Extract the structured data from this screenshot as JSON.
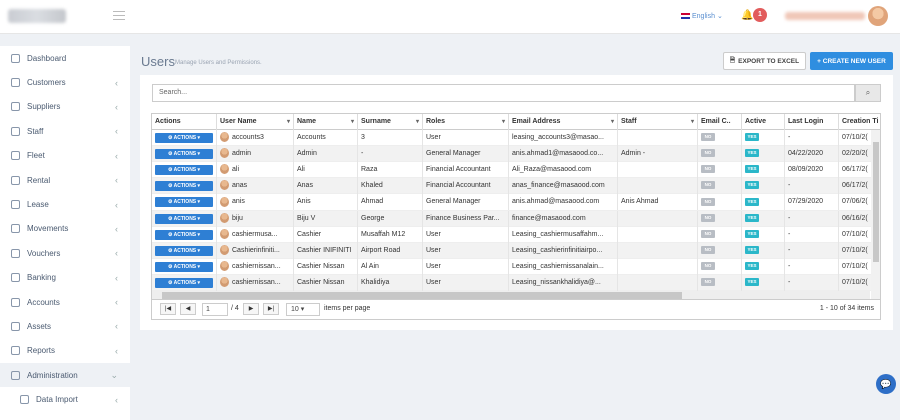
{
  "header": {
    "language": "English",
    "notifications_count": "1"
  },
  "sidebar": {
    "items": [
      {
        "label": "Dashboard",
        "icon": "home-icon",
        "chevron": false
      },
      {
        "label": "Customers",
        "icon": "users-icon",
        "chevron": true
      },
      {
        "label": "Suppliers",
        "icon": "suppliers-icon",
        "chevron": true
      },
      {
        "label": "Staff",
        "icon": "staff-icon",
        "chevron": true
      },
      {
        "label": "Fleet",
        "icon": "gauge-icon",
        "chevron": true
      },
      {
        "label": "Rental",
        "icon": "calendar-icon",
        "chevron": true
      },
      {
        "label": "Lease",
        "icon": "layers-icon",
        "chevron": true
      },
      {
        "label": "Movements",
        "icon": "car-icon",
        "chevron": true
      },
      {
        "label": "Vouchers",
        "icon": "ticket-icon",
        "chevron": true
      },
      {
        "label": "Banking",
        "icon": "bank-icon",
        "chevron": true
      },
      {
        "label": "Accounts",
        "icon": "ledger-icon",
        "chevron": true
      },
      {
        "label": "Assets",
        "icon": "diamond-icon",
        "chevron": true
      },
      {
        "label": "Reports",
        "icon": "chart-icon",
        "chevron": true
      },
      {
        "label": "Administration",
        "icon": "wrench-icon",
        "chevron": true,
        "active": true
      },
      {
        "label": "Data Import",
        "icon": "arrow-icon",
        "chevron": true,
        "sub": true
      }
    ]
  },
  "page": {
    "title": "Users",
    "subtitle": "Manage Users and Permissions.",
    "export_label": "EXPORT TO EXCEL",
    "create_label": "+ CREATE NEW USER",
    "search_placeholder": "Search..."
  },
  "table": {
    "columns": [
      "Actions",
      "User Name",
      "Name",
      "Surname",
      "Roles",
      "Email Address",
      "Staff",
      "Email C..",
      "Active",
      "Last Login",
      "Creation Ti"
    ],
    "action_label": "ACTIONS",
    "rows": [
      {
        "username": "accounts3",
        "name": "Accounts",
        "surname": "3",
        "role": "User",
        "email": "leasing_accounts3@masao...",
        "staff": "",
        "email_confirmed": "NO",
        "active": "YES",
        "last_login": "-",
        "creation": "07/10/2("
      },
      {
        "username": "admin",
        "name": "Admin",
        "surname": "-",
        "role": "General Manager",
        "email": "anis.ahmad1@masaood.co...",
        "staff": "Admin -",
        "email_confirmed": "NO",
        "active": "YES",
        "last_login": "04/22/2020",
        "creation": "02/20/2("
      },
      {
        "username": "ali",
        "name": "Ali",
        "surname": "Raza",
        "role": "Financial Accountant",
        "email": "Ali_Raza@masaood.com",
        "staff": "",
        "email_confirmed": "NO",
        "active": "YES",
        "last_login": "08/09/2020",
        "creation": "06/17/2("
      },
      {
        "username": "anas",
        "name": "Anas",
        "surname": "Khaled",
        "role": "Financial Accountant",
        "email": "anas_finance@masaood.com",
        "staff": "",
        "email_confirmed": "NO",
        "active": "YES",
        "last_login": "-",
        "creation": "06/17/2("
      },
      {
        "username": "anis",
        "name": "Anis",
        "surname": "Ahmad",
        "role": "General Manager",
        "email": "anis.ahmad@masaood.com",
        "staff": "Anis Ahmad",
        "email_confirmed": "NO",
        "active": "YES",
        "last_login": "07/29/2020",
        "creation": "07/06/2("
      },
      {
        "username": "biju",
        "name": "Biju V",
        "surname": "George",
        "role": "Finance Business Par...",
        "email": "finance@masaood.com",
        "staff": "",
        "email_confirmed": "NO",
        "active": "YES",
        "last_login": "-",
        "creation": "06/16/2("
      },
      {
        "username": "cashiermusa...",
        "name": "Cashier",
        "surname": "Musaffah M12",
        "role": "User",
        "email": "Leasing_cashiermusaffahm...",
        "staff": "",
        "email_confirmed": "NO",
        "active": "YES",
        "last_login": "-",
        "creation": "07/10/2("
      },
      {
        "username": "Cashierinfiniti...",
        "name": "Cashier INIFINITI",
        "surname": "Airport Road",
        "role": "User",
        "email": "Leasing_cashierinfinitiairpo...",
        "staff": "",
        "email_confirmed": "NO",
        "active": "YES",
        "last_login": "-",
        "creation": "07/10/2("
      },
      {
        "username": "cashiernissan...",
        "name": "Cashier Nissan",
        "surname": "Al Ain",
        "role": "User",
        "email": "Leasing_cashiernissanalain...",
        "staff": "",
        "email_confirmed": "NO",
        "active": "YES",
        "last_login": "-",
        "creation": "07/10/2("
      },
      {
        "username": "cashiernissan...",
        "name": "Cashier Nissan",
        "surname": "Khalidiya",
        "role": "User",
        "email": "Leasing_nissankhalidiya@...",
        "staff": "",
        "email_confirmed": "NO",
        "active": "YES",
        "last_login": "-",
        "creation": "07/10/2("
      }
    ]
  },
  "pager": {
    "page": "1",
    "of_pages": "/ 4",
    "page_size": "10",
    "items_per_page": "items per page",
    "summary": "1 - 10 of 34 items"
  }
}
